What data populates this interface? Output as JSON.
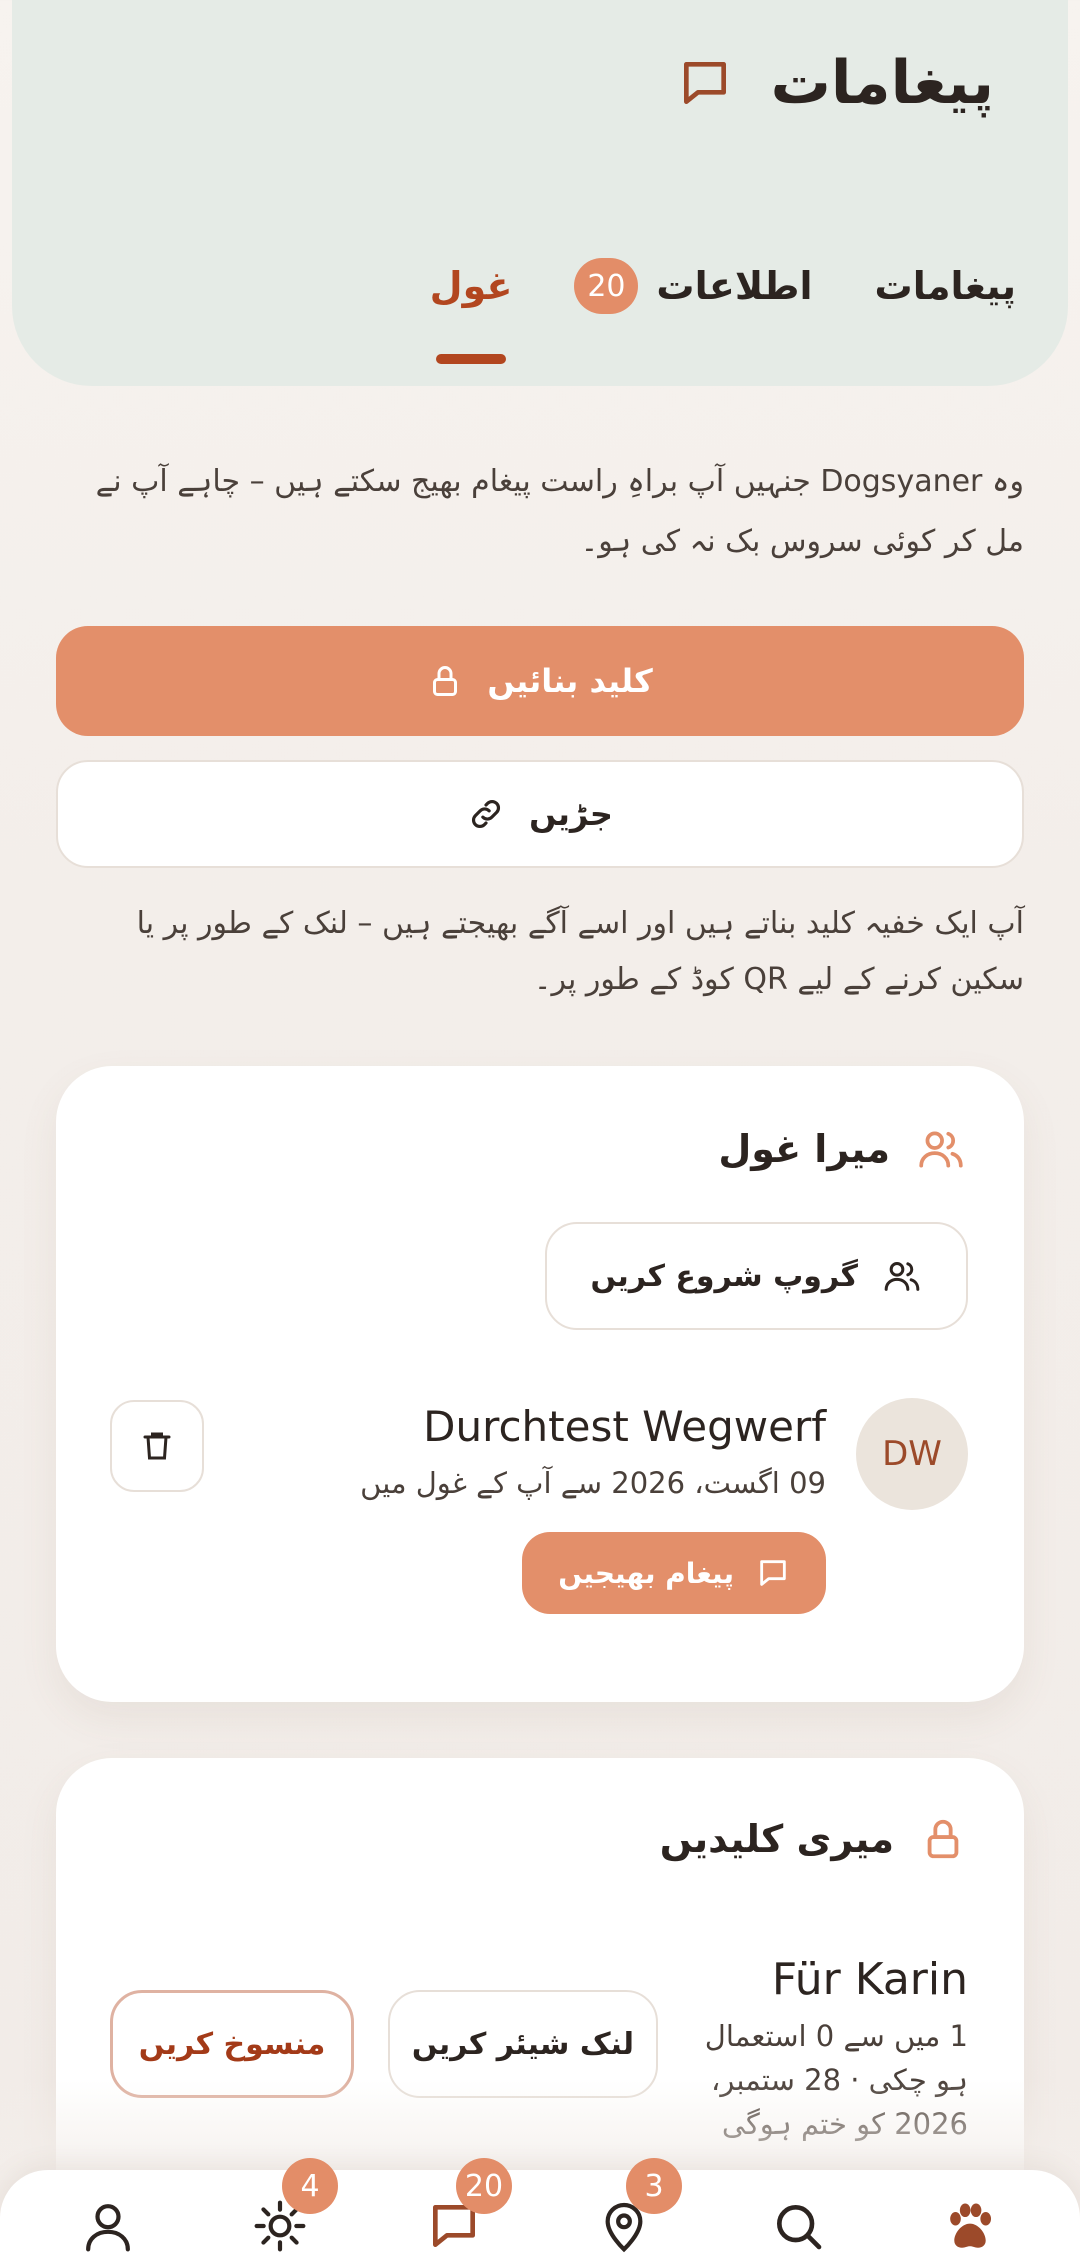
{
  "header": {
    "title": "پیغامات",
    "title_icon": "message-square-icon",
    "tabs": [
      {
        "label": "پیغامات",
        "active": false
      },
      {
        "label": "اطلاعات",
        "badge": "20",
        "active": false
      },
      {
        "label": "غول",
        "active": true
      }
    ]
  },
  "intro": {
    "text": "وہ Dogsyaner جنہیں آپ براہِ راست پیغام بھیج سکتے ہیں – چاہے آپ نے مل کر کوئی سروس بک نہ کی ہو۔"
  },
  "actions": {
    "create_key_label": "کلید بنائیں",
    "join_label": "جڑیں",
    "help_text": "آپ ایک خفیہ کلید بناتے ہیں اور اسے آگے بھیجتے ہیں – لنک کے طور پر یا سکین کرنے کے لیے QR کوڈ کے طور پر۔"
  },
  "my_pack": {
    "title": "میرا غول",
    "start_group_label": "گروپ شروع کریں",
    "member": {
      "initials": "DW",
      "name": "Durchtest Wegwerf",
      "since": "09 اگست، 2026 سے آپ کے غول میں",
      "send_label": "پیغام بھیجیں"
    }
  },
  "my_keys": {
    "title": "میری کلیدیں",
    "key": {
      "name": "Für Karin",
      "usage": "1 میں سے 0 استعمال ہو چکی · 28 ستمبر، 2026 کو ختم ہوگی",
      "share_label": "لنک شیئر کریں",
      "revoke_label": "منسوخ کریں"
    }
  },
  "bottom_nav": {
    "items": [
      {
        "icon": "paw-icon"
      },
      {
        "icon": "search-icon"
      },
      {
        "icon": "map-pin-icon",
        "badge": "3"
      },
      {
        "icon": "message-icon",
        "badge": "20"
      },
      {
        "icon": "sun-icon",
        "badge": "4"
      },
      {
        "icon": "user-icon"
      }
    ]
  },
  "colors": {
    "accent": "#e38f6a",
    "accent_dark": "#b2461f",
    "header_bg": "#e5ebe6"
  }
}
